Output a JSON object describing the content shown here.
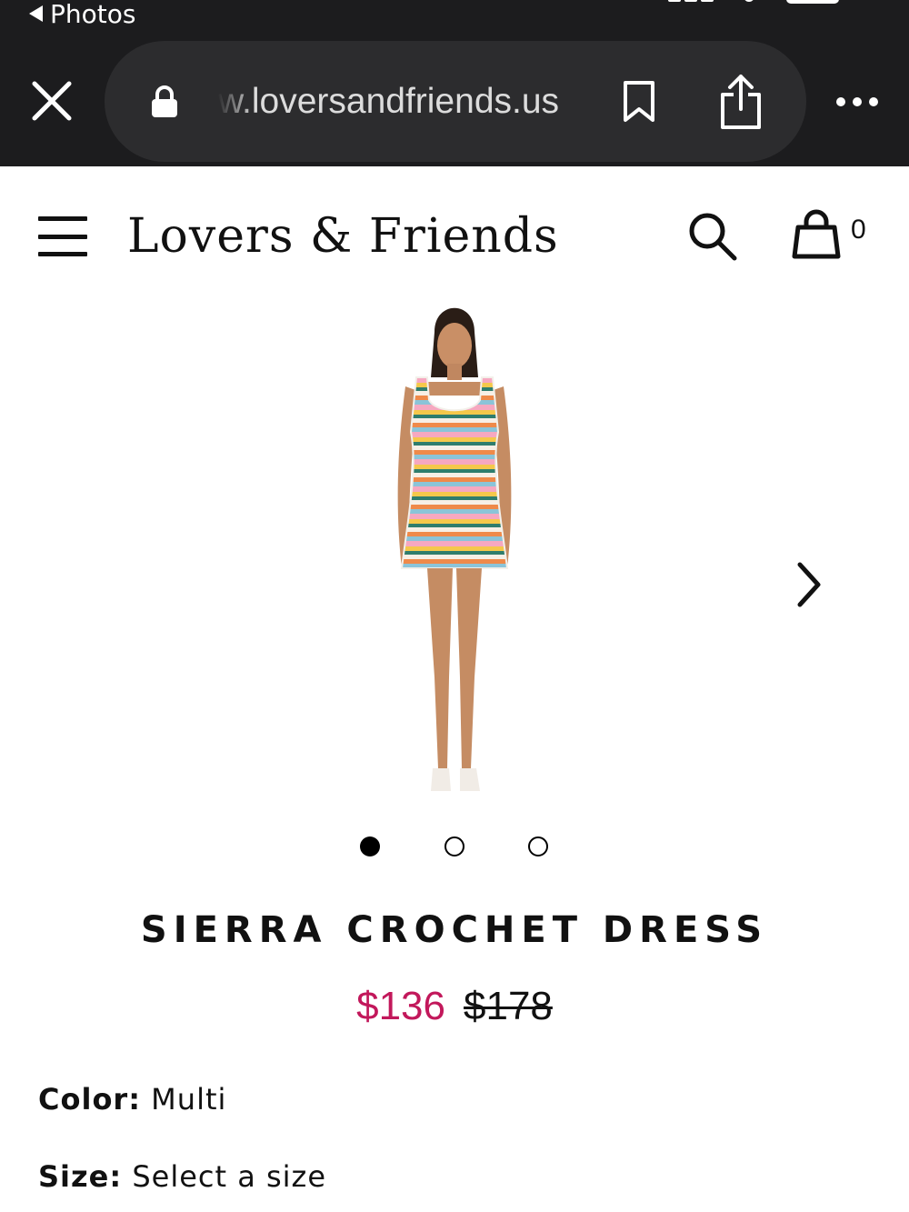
{
  "status_bar": {
    "back_label": "Photos"
  },
  "browser": {
    "url": "w.loversandfriends.us",
    "icons": [
      "close-icon",
      "lock-icon",
      "bookmark-icon",
      "share-icon",
      "more-icon"
    ]
  },
  "header": {
    "logo_text": "Lovers & Friends",
    "cart_count": "0",
    "icons": [
      "menu-icon",
      "search-icon",
      "shopping-bag-icon"
    ]
  },
  "product": {
    "title": "SIERRA CROCHET DRESS",
    "sale_price": "$136",
    "original_price": "$178",
    "sale_price_color": "#c2185b",
    "image_count": 3,
    "active_image_index": 0,
    "color_label": "Color:",
    "color_value": "Multi",
    "size_label": "Size:",
    "size_value": "Select a size"
  }
}
